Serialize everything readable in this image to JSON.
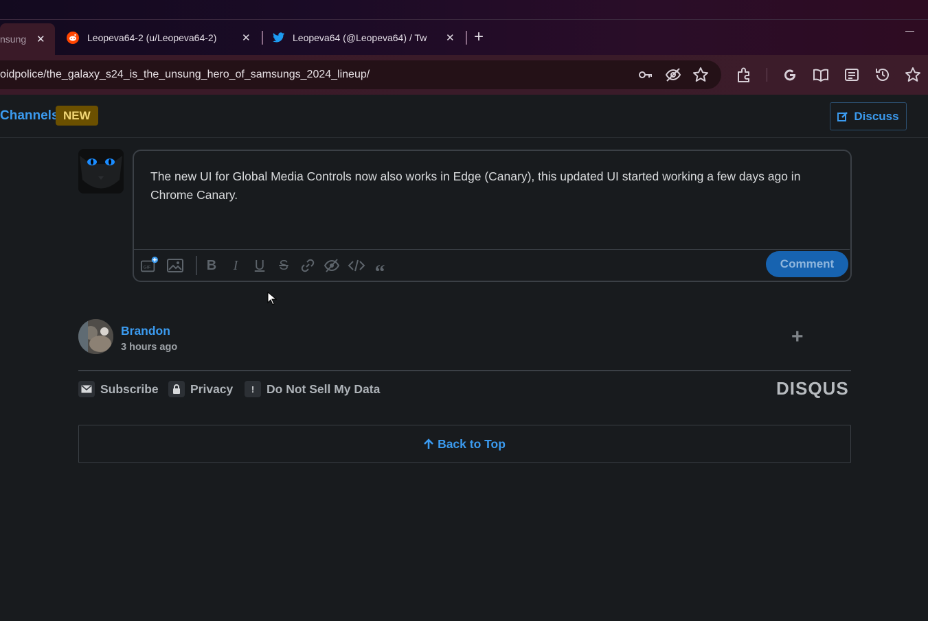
{
  "browser": {
    "tabs": [
      {
        "label": "nsung",
        "active": true
      },
      {
        "label": "Leopeva64-2 (u/Leopeva64-2)",
        "favicon": "reddit-icon"
      },
      {
        "label": "Leopeva64 (@Leopeva64) / Tw",
        "favicon": "twitter-icon"
      }
    ],
    "url": "oidpolice/the_galaxy_s24_is_the_unsung_hero_of_samsungs_2024_lineup/",
    "close_glyph": "✕",
    "new_tab_glyph": "+",
    "toolbar_icons": [
      "key-icon",
      "eye-off-icon",
      "star-icon",
      "extensions-icon",
      "google-icon",
      "reading-mode-icon",
      "reading-list-icon",
      "history-icon",
      "favorites-icon"
    ]
  },
  "nav": {
    "channels": "Channels",
    "new_badge": "NEW",
    "discuss": "Discuss"
  },
  "composer": {
    "text": "The new UI for Global Media Controls now also works in Edge (Canary), this updated UI started working a few days ago in Chrome Canary.",
    "comment_button": "Comment",
    "format_icons": [
      "gif-icon",
      "image-icon",
      "bold-icon",
      "italic-icon",
      "underline-icon",
      "strikethrough-icon",
      "link-icon",
      "spoiler-icon",
      "code-icon",
      "quote-icon"
    ]
  },
  "comment": {
    "author": "Brandon",
    "time": "3 hours ago",
    "expand": "+"
  },
  "footer": {
    "subscribe": "Subscribe",
    "privacy": "Privacy",
    "do_not_sell": "Do Not Sell My Data",
    "logo": "DISQUS",
    "back_to_top": "Back to Top"
  },
  "colors": {
    "accent": "#3b9bf0",
    "comment_button": "#1763b0",
    "badge": "#6b5000",
    "background": "#181b1e"
  }
}
